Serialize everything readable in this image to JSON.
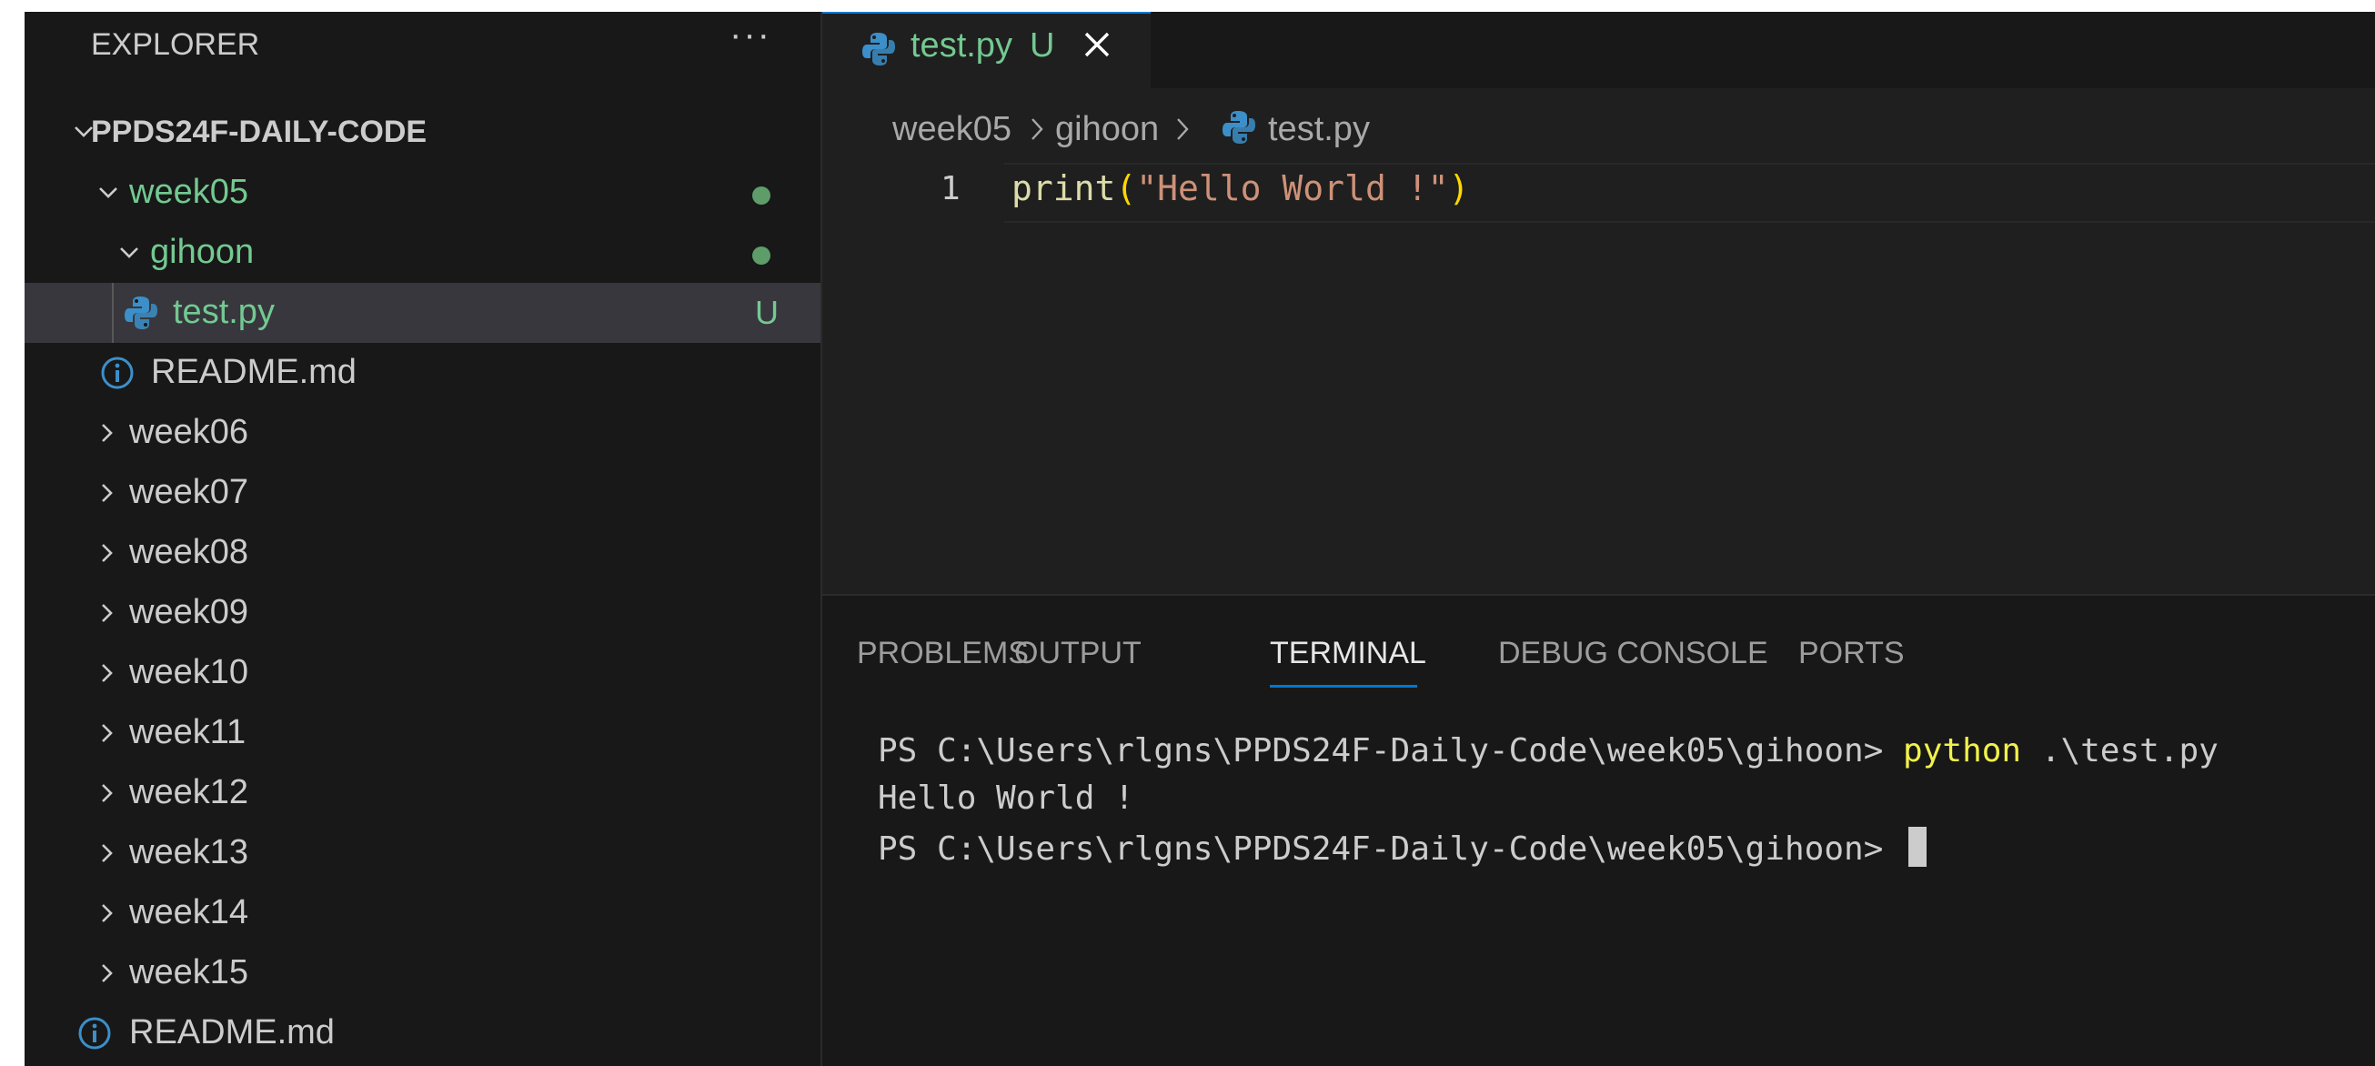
{
  "explorer": {
    "title": "EXPLORER",
    "more_label": "···",
    "root": "PPDS24F-DAILY-CODE",
    "tree": [
      {
        "label": "week05",
        "status_dot": true
      },
      {
        "label": "gihoon",
        "status_dot": true
      },
      {
        "label": "test.py",
        "badge": "U"
      },
      {
        "label": "README.md"
      },
      {
        "label": "week06"
      },
      {
        "label": "week07"
      },
      {
        "label": "week08"
      },
      {
        "label": "week09"
      },
      {
        "label": "week10"
      },
      {
        "label": "week11"
      },
      {
        "label": "week12"
      },
      {
        "label": "week13"
      },
      {
        "label": "week14"
      },
      {
        "label": "week15"
      },
      {
        "label": "README.md"
      }
    ]
  },
  "editor": {
    "tab": {
      "label": "test.py",
      "badge": "U"
    },
    "breadcrumb": [
      "week05",
      "gihoon",
      "test.py"
    ],
    "lines": [
      {
        "number": "1",
        "fn": "print",
        "open": "(",
        "str": "\"Hello World !\"",
        "close": ")"
      }
    ]
  },
  "panel": {
    "tabs": [
      "PROBLEMS",
      "OUTPUT",
      "TERMINAL",
      "DEBUG CONSOLE",
      "PORTS"
    ],
    "active_tab": "TERMINAL",
    "terminal": {
      "line1_prompt": "PS C:\\Users\\rlgns\\PPDS24F-Daily-Code\\week05\\gihoon> ",
      "line1_cmd": "python",
      "line1_args": " .\\test.py",
      "line2": "Hello World !",
      "line3_prompt": "PS C:\\Users\\rlgns\\PPDS24F-Daily-Code\\week05\\gihoon> "
    }
  },
  "colors": {
    "accent": "#0078d4",
    "untracked": "#73c991",
    "python_icon": "#3c8fc9",
    "info_icon": "#3c8fc9"
  }
}
